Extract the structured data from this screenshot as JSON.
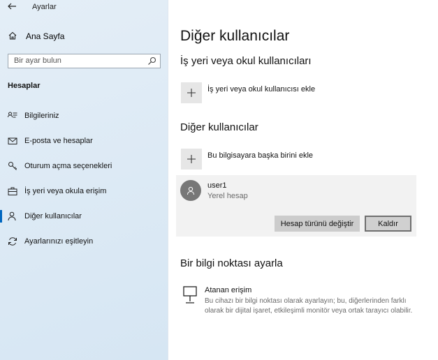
{
  "window": {
    "title": "Ayarlar"
  },
  "sidebar": {
    "home_label": "Ana Sayfa",
    "search": {
      "placeholder": "Bir ayar bulun"
    },
    "section_header": "Hesaplar",
    "items": [
      {
        "label": "Bilgileriniz",
        "icon": "person-info-icon",
        "active": false
      },
      {
        "label": "E-posta ve hesaplar",
        "icon": "mail-icon",
        "active": false
      },
      {
        "label": "Oturum açma seçenekleri",
        "icon": "key-icon",
        "active": false
      },
      {
        "label": "İş yeri veya okula erişim",
        "icon": "briefcase-icon",
        "active": false
      },
      {
        "label": "Diğer kullanıcılar",
        "icon": "person-icon",
        "active": true
      },
      {
        "label": "Ayarlarınızı eşitleyin",
        "icon": "sync-icon",
        "active": false
      }
    ]
  },
  "main": {
    "title": "Diğer kullanıcılar",
    "work_section": {
      "title": "İş yeri veya okul kullanıcıları",
      "add_label": "İş yeri veya okul kullanıcısı ekle"
    },
    "other_section": {
      "title": "Diğer kullanıcılar",
      "add_label": "Bu bilgisayara başka birini ekle"
    },
    "user": {
      "name": "user1",
      "type": "Yerel hesap",
      "change_type_button": "Hesap türünü değiştir",
      "remove_button": "Kaldır"
    },
    "kiosk_section": {
      "title": "Bir bilgi noktası ayarla",
      "item_title": "Atanan erişim",
      "item_desc": "Bu cihazı bir bilgi noktası olarak ayarlayın; bu, diğerlerinden farklı olarak bir dijital işaret, etkileşimli monitör veya ortak tarayıcı olabilir."
    }
  },
  "colors": {
    "accent": "#0067c0",
    "sidebar_bg": "#dbe8f4",
    "add_button_bg": "#e6e6e6",
    "user_card_bg": "#f2f2f2",
    "avatar_bg": "#777777"
  }
}
